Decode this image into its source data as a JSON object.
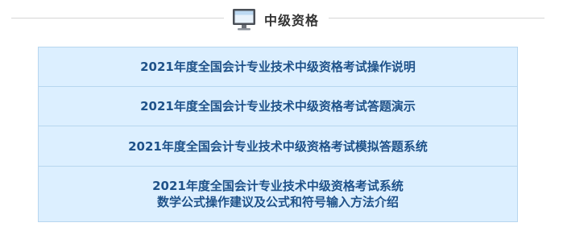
{
  "header": {
    "icon": "monitor-icon",
    "title": "中级资格"
  },
  "items": [
    {
      "line1": "2021年度全国会计专业技术中级资格考试操作说明"
    },
    {
      "line1": "2021年度全国会计专业技术中级资格考试答题演示"
    },
    {
      "line1": "2021年度全国会计专业技术中级资格考试模拟答题系统"
    },
    {
      "line1": "2021年度全国会计专业技术中级资格考试系统",
      "line2": "数学公式操作建议及公式和符号输入方法介绍"
    }
  ],
  "colors": {
    "item_background": "#dcefff",
    "item_border": "#b7d6ef",
    "item_text": "#1f5289",
    "header_text": "#333333",
    "divider": "#d6d6d6"
  }
}
